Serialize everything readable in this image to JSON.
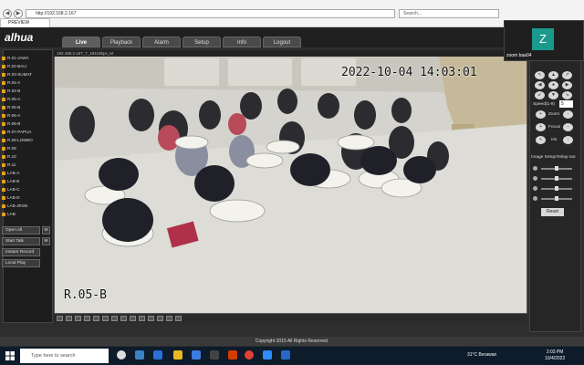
{
  "browser": {
    "url": "http://192.168.2.167",
    "search_placeholder": "Search...",
    "tab_title": "PREVIEW",
    "nav_back": "◀",
    "nav_forward": "▶"
  },
  "app": {
    "logo": "alhua",
    "menu": [
      "Live",
      "Playback",
      "Alarm",
      "Setup",
      "Info",
      "Logout"
    ],
    "active_tab": "Live",
    "copyright": "Copyright 2015 All Rights Reserved."
  },
  "camera_list": [
    "R.01-JAWA",
    "R.02-BALI",
    "R.03-SUMAT",
    "R.04-A",
    "R.04-B",
    "R.05-A",
    "R.05-B",
    "R.06-A",
    "R.06-B",
    "R.07-PAPUA",
    "R.08-LOMBO",
    "R.09",
    "R.10",
    "R.11",
    "LAB-A",
    "LAB-B",
    "LAB-C",
    "LAB-D",
    "LAB-JRSN",
    "LAB-"
  ],
  "side_buttons": {
    "open_all": "Open All",
    "start_talk": "Start Talk",
    "instant_record": "Instant Record",
    "local_play": "Local Play",
    "m_label": "M"
  },
  "video": {
    "stream_label": "192.168.2.167_7_18116bps_M",
    "osd_timestamp": "2022-10-04 14:03:01",
    "osd_room": "R.05-B"
  },
  "zoom": {
    "avatar_letter": "Z",
    "name": "zoom baa04"
  },
  "ptz": {
    "speed_label": "Speed(1-8)",
    "speed_value": "5",
    "zoom_label": "Zoom",
    "focus_label": "Focus",
    "iris_label": "Iris",
    "plus": "+",
    "minus": "-",
    "image_setup_label": "Image Setup",
    "relay_out_label": "Relay-out",
    "reset_label": "Reset"
  },
  "taskbar": {
    "search_placeholder": "Type here to search",
    "weather": "31°C Berawan",
    "time": "2:03 PM",
    "date": "10/4/2022"
  }
}
